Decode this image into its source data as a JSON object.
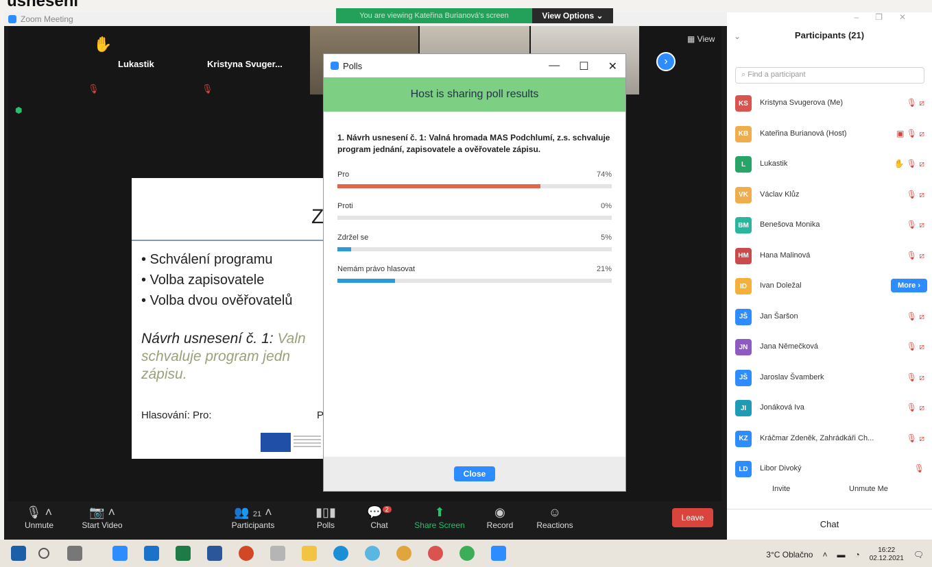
{
  "doc_title": "usnesení",
  "window_title": "Zoom Meeting",
  "share_banner": "You are viewing Kateřina Burianová's screen",
  "view_options": "View Options ⌄",
  "view_label": "View",
  "tiles": [
    {
      "name": "Lukastik"
    },
    {
      "name": "Kristyna Svuger..."
    }
  ],
  "slide": {
    "title": "Z",
    "bullets": [
      "• Schválení programu",
      "• Volba zapisovatele",
      "• Volba dvou ověřovatelů"
    ],
    "motion_label": "Návrh usnesení č. 1:",
    "motion_rest_1": " Valn",
    "motion_rest_2": "schvaluje program jedn",
    "motion_rest_3": "zápisu.",
    "vote": "Hlasování: Pro:",
    "vote_p": "P"
  },
  "poll": {
    "title": "Polls",
    "banner": "Host is sharing poll results",
    "question": "1. Návrh usnesení č. 1: Valná hromada MAS Podchlumí, z.s. schvaluje program jednání, zapisovatele a ověřovatele zápisu.",
    "options": [
      {
        "label": "Pro",
        "pct": "74%",
        "value": 74,
        "color": "#e0664a"
      },
      {
        "label": "Proti",
        "pct": "0%",
        "value": 0,
        "color": "#2d9ad8"
      },
      {
        "label": "Zdržel se",
        "pct": "5%",
        "value": 5,
        "color": "#2d9ad8"
      },
      {
        "label": "Nemám právo hlasovat",
        "pct": "21%",
        "value": 21,
        "color": "#2d9ad8"
      }
    ],
    "close_label": "Close"
  },
  "toolbar": {
    "unmute": "Unmute",
    "start_video": "Start Video",
    "participants": "Participants",
    "participants_count": "21",
    "polls": "Polls",
    "chat": "Chat",
    "chat_badge": "2",
    "share_screen": "Share Screen",
    "record": "Record",
    "reactions": "Reactions",
    "leave": "Leave"
  },
  "panel": {
    "title": "Participants (21)",
    "search_placeholder": "Find a participant",
    "participants": [
      {
        "initials": "KS",
        "name": "Kristyna Svugerova (Me)",
        "color": "#d9534f",
        "icons": "🎙 ⧄"
      },
      {
        "initials": "KB",
        "name": "Kateřina Burianová (Host)",
        "color": "#f0ad4e",
        "icons": "▣ 🎙 ⧄"
      },
      {
        "initials": "L",
        "name": "Lukastik",
        "color": "#27a567",
        "icons": "✋ 🎙 ⧄"
      },
      {
        "initials": "VK",
        "name": "Václav Klůz",
        "color": "#f0ad4e",
        "icons": "🎙 ⧄"
      },
      {
        "initials": "BM",
        "name": "Benešova Monika",
        "color": "#2bb59a",
        "icons": "🎙 ⧄"
      },
      {
        "initials": "HM",
        "name": "Hana Malinová",
        "color": "#c94b4b",
        "icons": "🎙 ⧄"
      },
      {
        "initials": "ID",
        "name": "Ivan Doležal",
        "color": "#f4b13a",
        "icons": ""
      },
      {
        "initials": "JŠ",
        "name": "Jan Šaršon",
        "color": "#2d8cff",
        "icons": "🎙 ⧄"
      },
      {
        "initials": "JN",
        "name": "Jana Němečková",
        "color": "#8e5bc2",
        "icons": "🎙 ⧄"
      },
      {
        "initials": "JŠ",
        "name": "Jaroslav Švamberk",
        "color": "#2d8cff",
        "icons": "🎙 ⧄"
      },
      {
        "initials": "JI",
        "name": "Jonáková Iva",
        "color": "#1e9bb5",
        "icons": "🎙 ⧄"
      },
      {
        "initials": "KZ",
        "name": "Kráčmar Zdeněk, Zahrádkáři Ch...",
        "color": "#2d8cff",
        "icons": "🎙 ⧄"
      },
      {
        "initials": "LD",
        "name": "Libor Divoký",
        "color": "#2d8cff",
        "icons": "🎙"
      }
    ],
    "more_label": "More ›",
    "invite": "Invite",
    "unmute_me": "Unmute Me",
    "chat": "Chat"
  },
  "taskbar": {
    "weather": "3°C  Oblačno",
    "time": "16:22",
    "date": "02.12.2021"
  }
}
